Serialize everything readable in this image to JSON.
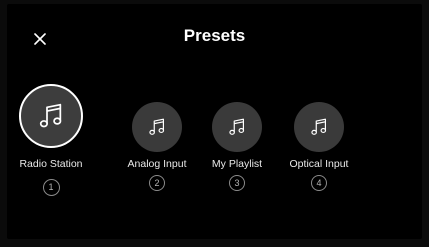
{
  "header": {
    "title": "Presets",
    "close_icon": "close-icon"
  },
  "presets": [
    {
      "label": "Radio Station",
      "number": "1",
      "icon": "music-note-icon",
      "selected": true
    },
    {
      "label": "Analog Input",
      "number": "2",
      "icon": "music-note-icon",
      "selected": false
    },
    {
      "label": "My Playlist",
      "number": "3",
      "icon": "music-note-icon",
      "selected": false
    },
    {
      "label": "Optical Input",
      "number": "4",
      "icon": "music-note-icon",
      "selected": false
    }
  ],
  "colors": {
    "background": "#000000",
    "circle": "#3a3a3a",
    "selected_ring": "#ffffff",
    "text": "#ffffff"
  }
}
